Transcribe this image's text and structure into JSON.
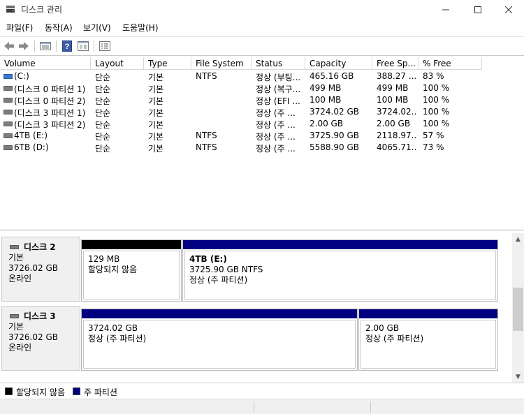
{
  "window": {
    "title": "디스크 관리",
    "minimize": "—",
    "maximize": "☐",
    "close": "✕"
  },
  "menu": [
    "파일(F)",
    "동작(A)",
    "보기(V)",
    "도움말(H)"
  ],
  "toolbar": {
    "buttons": [
      "back-arrow-icon",
      "forward-arrow-icon",
      "disk-list-icon",
      "help-icon",
      "properties-icon",
      "console-icon"
    ]
  },
  "volume_list": {
    "columns": [
      "Volume",
      "Layout",
      "Type",
      "File System",
      "Status",
      "Capacity",
      "Free Sp...",
      "% Free"
    ],
    "rows": [
      {
        "volume": "(C:)",
        "layout": "단순",
        "type": "기본",
        "fs": "NTFS",
        "status": "정상 (부팅...",
        "capacity": "465.16 GB",
        "free": "388.27 ...",
        "pct": "83 %",
        "system": true
      },
      {
        "volume": "(디스크 0 파티션 1)",
        "layout": "단순",
        "type": "기본",
        "fs": "",
        "status": "정상 (복구...",
        "capacity": "499 MB",
        "free": "499 MB",
        "pct": "100 %",
        "system": false
      },
      {
        "volume": "(디스크 0 파티션 2)",
        "layout": "단순",
        "type": "기본",
        "fs": "",
        "status": "정상 (EFI ...",
        "capacity": "100 MB",
        "free": "100 MB",
        "pct": "100 %",
        "system": false
      },
      {
        "volume": "(디스크 3 파티션 1)",
        "layout": "단순",
        "type": "기본",
        "fs": "",
        "status": "정상 (주 ...",
        "capacity": "3724.02 GB",
        "free": "3724.02...",
        "pct": "100 %",
        "system": false
      },
      {
        "volume": "(디스크 3 파티션 2)",
        "layout": "단순",
        "type": "기본",
        "fs": "",
        "status": "정상 (주 ...",
        "capacity": "2.00 GB",
        "free": "2.00 GB",
        "pct": "100 %",
        "system": false
      },
      {
        "volume": "4TB (E:)",
        "layout": "단순",
        "type": "기본",
        "fs": "NTFS",
        "status": "정상 (주 ...",
        "capacity": "3725.90 GB",
        "free": "2118.97...",
        "pct": "57 %",
        "system": false
      },
      {
        "volume": "6TB (D:)",
        "layout": "단순",
        "type": "기본",
        "fs": "NTFS",
        "status": "정상 (주 ...",
        "capacity": "5588.90 GB",
        "free": "4065.71...",
        "pct": "73 %",
        "system": false
      }
    ]
  },
  "disks": [
    {
      "name": "디스크 2",
      "kind": "기본",
      "size": "3726.02 GB",
      "state": "온라인",
      "partitions": [
        {
          "title": "",
          "line1": "129 MB",
          "line2": "할당되지 않음",
          "color": "#000000"
        },
        {
          "title": "4TB  (E:)",
          "line1": "3725.90 GB NTFS",
          "line2": "정상 (주 파티션)",
          "color": "#000080"
        }
      ]
    },
    {
      "name": "디스크 3",
      "kind": "기본",
      "size": "3726.02 GB",
      "state": "온라인",
      "partitions": [
        {
          "title": "",
          "line1": "3724.02 GB",
          "line2": "정상 (주 파티션)",
          "color": "#000080"
        },
        {
          "title": "",
          "line1": "2.00 GB",
          "line2": "정상 (주 파티션)",
          "color": "#000080"
        }
      ]
    }
  ],
  "legend": [
    {
      "label": "할당되지 않음",
      "color": "#000000"
    },
    {
      "label": "주 파티션",
      "color": "#000080"
    }
  ]
}
